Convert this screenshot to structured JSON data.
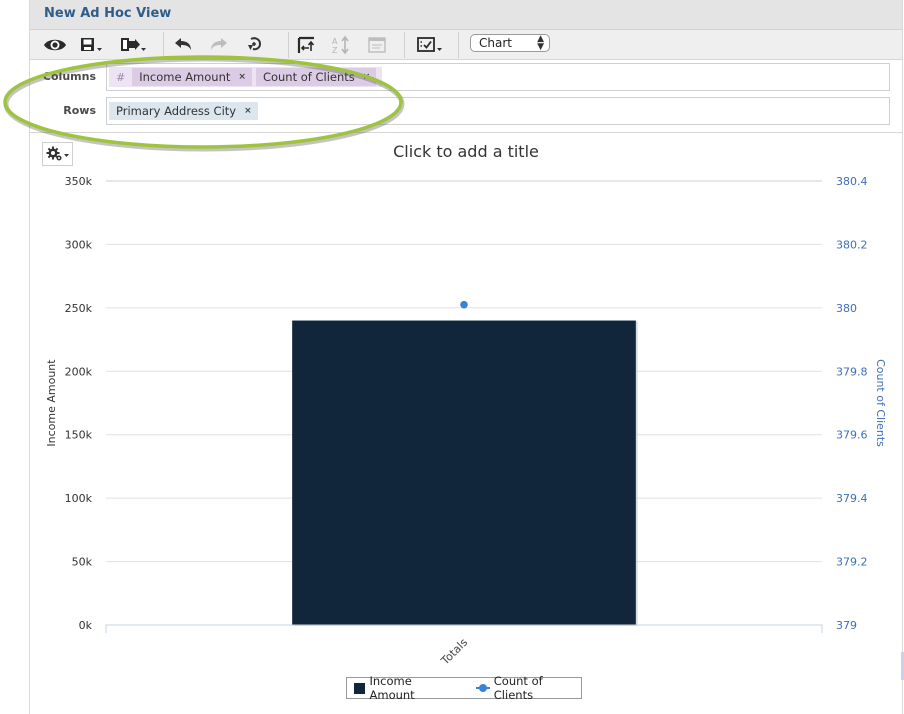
{
  "window": {
    "title": "New Ad Hoc View"
  },
  "toolbar": {
    "icons": [
      "eye-icon",
      "save-icon",
      "export-icon",
      "undo-icon",
      "redo-icon",
      "undo-all-icon",
      "pivot-icon",
      "sort-icon",
      "input-controls-icon",
      "select-fields-icon"
    ],
    "view_type_select": {
      "selected": "Chart"
    }
  },
  "fields": {
    "columns_label": "Columns",
    "rows_label": "Rows",
    "measures_glyph": "#",
    "columns": [
      {
        "label": "Income Amount",
        "remove": "×"
      },
      {
        "label": "Count of Clients",
        "remove": "×"
      }
    ],
    "rows": [
      {
        "label": "Primary Address City",
        "remove": "×"
      }
    ]
  },
  "chart": {
    "title_placeholder": "Click to add a title"
  },
  "legend": {
    "items": [
      {
        "label": "Income Amount",
        "color": "#12263b"
      },
      {
        "label": "Count of Clients",
        "color": "#3b82d6"
      }
    ]
  },
  "colors": {
    "title_text": "#2e5d8a",
    "bar": "#12263b",
    "line": "#3b82d6",
    "right_axis": "#3d6fb8",
    "highlight_ellipse": "#9dc43c"
  },
  "chart_data": {
    "type": "bar",
    "title": "",
    "categories": [
      "Totals"
    ],
    "series": [
      {
        "name": "Income Amount",
        "type": "bar",
        "axis": "left",
        "values": [
          240000
        ]
      },
      {
        "name": "Count of Clients",
        "type": "line",
        "axis": "right",
        "values": [
          380.01
        ]
      }
    ],
    "left_axis": {
      "label": "Income Amount",
      "range": [
        0,
        350000
      ],
      "ticks": [
        0,
        50000,
        100000,
        150000,
        200000,
        250000,
        300000,
        350000
      ],
      "tick_labels": [
        "0k",
        "50k",
        "100k",
        "150k",
        "200k",
        "250k",
        "300k",
        "350k"
      ]
    },
    "right_axis": {
      "label": "Count of Clients",
      "range": [
        379,
        380.4
      ],
      "ticks": [
        379,
        379.2,
        379.4,
        379.6,
        379.8,
        380,
        380.2,
        380.4
      ],
      "tick_labels": [
        "379",
        "379.2",
        "379.4",
        "379.6",
        "379.8",
        "380",
        "380.2",
        "380.4"
      ]
    },
    "xlabel": "",
    "grid": true,
    "legend_position": "bottom-center"
  }
}
